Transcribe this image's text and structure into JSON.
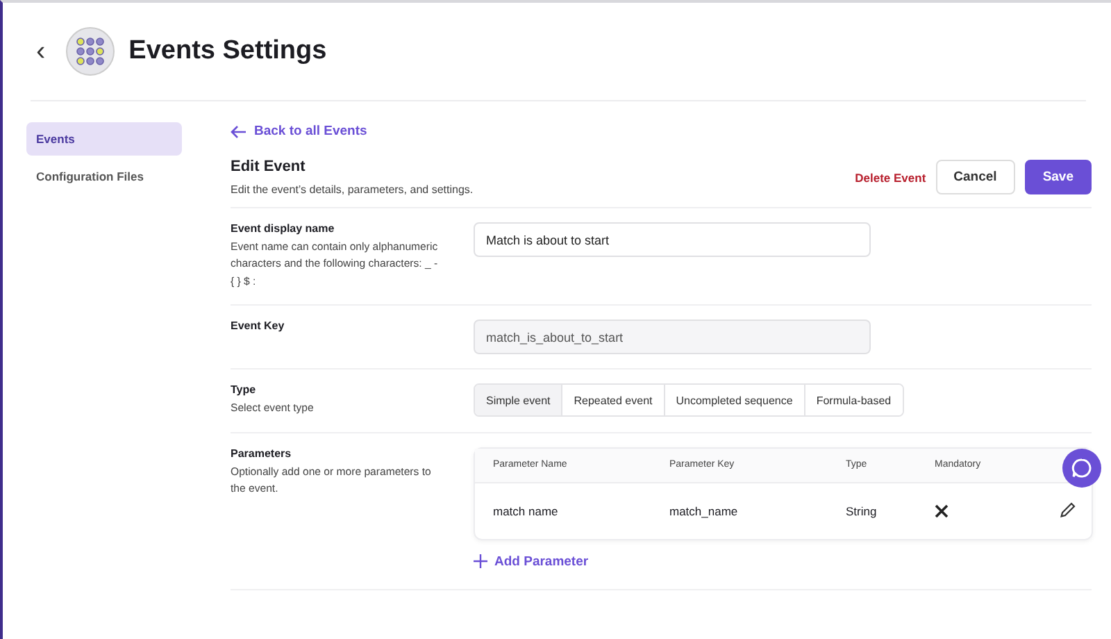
{
  "header": {
    "back": "‹",
    "title": "Events Settings"
  },
  "sidebar": {
    "items": [
      {
        "label": "Events",
        "selected": true
      },
      {
        "label": "Configuration Files",
        "selected": false
      }
    ]
  },
  "back_link": "Back to all Events",
  "edit": {
    "title": "Edit Event",
    "subtitle": "Edit the event’s details, parameters, and settings.",
    "delete": "Delete Event",
    "cancel": "Cancel",
    "save": "Save"
  },
  "fields": [
    {
      "kind": "input",
      "label": "Event display name",
      "help": "Event name can contain only alphanumeric characters and the following characters: _ - { } $ :",
      "value": "Match is about to start",
      "disabled": false
    },
    {
      "kind": "input",
      "label": "Event Key",
      "value": "match_is_about_to_start",
      "disabled": true
    },
    {
      "kind": "segments",
      "label": "Type",
      "help": "Select event type",
      "options": [
        {
          "label": "Simple event",
          "selected": true
        },
        {
          "label": "Repeated event",
          "selected": false
        },
        {
          "label": "Uncompleted sequence",
          "selected": false
        },
        {
          "label": "Formula-based",
          "selected": false
        }
      ]
    },
    {
      "kind": "table",
      "label": "Parameters",
      "help": "Optionally add one or more parameters to the event.",
      "columns": [
        "Parameter Name",
        "Parameter Key",
        "Type",
        "Mandatory"
      ],
      "rows": [
        {
          "name": "match name",
          "key": "match_name",
          "type": "String",
          "mandatory": false
        }
      ],
      "add": "Add Parameter"
    }
  ]
}
